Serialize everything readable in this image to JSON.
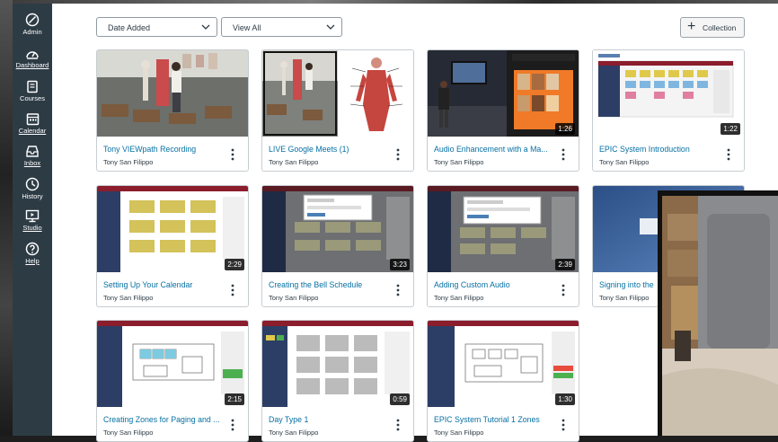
{
  "sidebar": {
    "items": [
      {
        "label": "Admin",
        "icon": "shield-icon"
      },
      {
        "label": "Dashboard",
        "icon": "speedometer-icon"
      },
      {
        "label": "Courses",
        "icon": "book-icon"
      },
      {
        "label": "Calendar",
        "icon": "calendar-icon"
      },
      {
        "label": "Inbox",
        "icon": "inbox-icon"
      },
      {
        "label": "History",
        "icon": "clock-icon"
      },
      {
        "label": "Studio",
        "icon": "studio-icon"
      },
      {
        "label": "Help",
        "icon": "question-icon"
      }
    ]
  },
  "toolbar": {
    "sort_value": "Date Added",
    "filter_value": "View All",
    "collection_label": "Collection"
  },
  "videos": [
    {
      "title": "Tony VIEWpath Recording",
      "author": "Tony San Filippo",
      "duration": ""
    },
    {
      "title": "LIVE Google Meets (1)",
      "author": "Tony San Filippo",
      "duration": ""
    },
    {
      "title": "Audio Enhancement with a Ma...",
      "author": "Tony San Filippo",
      "duration": "1:26"
    },
    {
      "title": "EPIC System Introduction",
      "author": "Tony San Filippo",
      "duration": "1:22"
    },
    {
      "title": "Setting Up Your Calendar",
      "author": "Tony San Filippo",
      "duration": "2:29"
    },
    {
      "title": "Creating the Bell Schedule",
      "author": "Tony San Filippo",
      "duration": "3:23"
    },
    {
      "title": "Adding Custom Audio",
      "author": "Tony San Filippo",
      "duration": "2:39"
    },
    {
      "title": "Signing into the",
      "author": "Tony San Filippo",
      "duration": ""
    },
    {
      "title": "Creating Zones for Paging and ...",
      "author": "Tony San Filippo",
      "duration": "2:15"
    },
    {
      "title": "Day Type 1",
      "author": "Tony San Filippo",
      "duration": "0:59"
    },
    {
      "title": "EPIC System Tutorial 1 Zones",
      "author": "Tony San Filippo",
      "duration": "1:30"
    }
  ],
  "colors": {
    "sidebar": "#2d3b45",
    "link": "#0770a3",
    "text": "#2d3b45",
    "appbar": "#8b1d2c",
    "calendar_yellow": "#d4c25a"
  }
}
